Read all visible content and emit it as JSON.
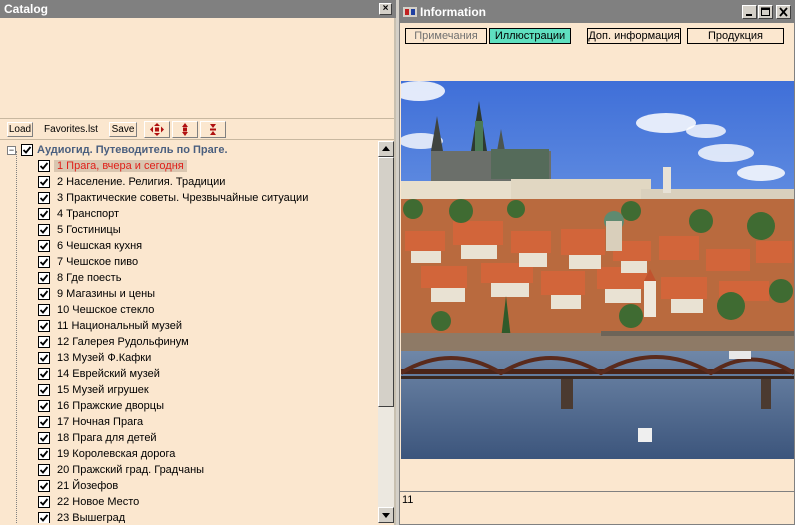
{
  "catalog": {
    "title": "Catalog",
    "toolbar": {
      "load_label": "Load",
      "list_label": "Favorites.lst",
      "save_label": "Save"
    },
    "root": "Аудиогид. Путеводитель по Праге.",
    "items": [
      "1 Прага, вчера и сегодня",
      "2 Население. Религия. Традиции",
      "3 Практические советы. Чрезвычайные ситуации",
      "4 Транспорт",
      "5 Гостиницы",
      "6 Чешская кухня",
      "7 Чешское пиво",
      "8 Где поесть",
      "9 Магазины и цены",
      "10 Чешское стекло",
      "11 Национальный музей",
      "12 Галерея Рудольфинум",
      "13 Музей Ф.Кафки",
      "14 Еврейский музей",
      "15 Музей игрушек",
      "16 Пражские дворцы",
      "17 Ночная Прага",
      "18 Прага для детей",
      "19 Королевская дорога",
      "20 Пражский град. Градчаны",
      "21 Йозефов",
      "22 Новое Место",
      "23 Вышеград"
    ],
    "selected_index": 0
  },
  "info": {
    "title": "Information",
    "tabs": [
      {
        "label": "Примечания",
        "state": "dim"
      },
      {
        "label": "Иллюстрации",
        "state": "active"
      },
      {
        "label": "Доп. информация",
        "state": "normal"
      },
      {
        "label": "Продукция",
        "state": "normal"
      }
    ],
    "status_text": "11"
  },
  "colors": {
    "panel_bg": "#fbe7cf",
    "titlebar": "#808080",
    "active_tab": "#5fe0c0",
    "selected_text": "#e0201a"
  }
}
